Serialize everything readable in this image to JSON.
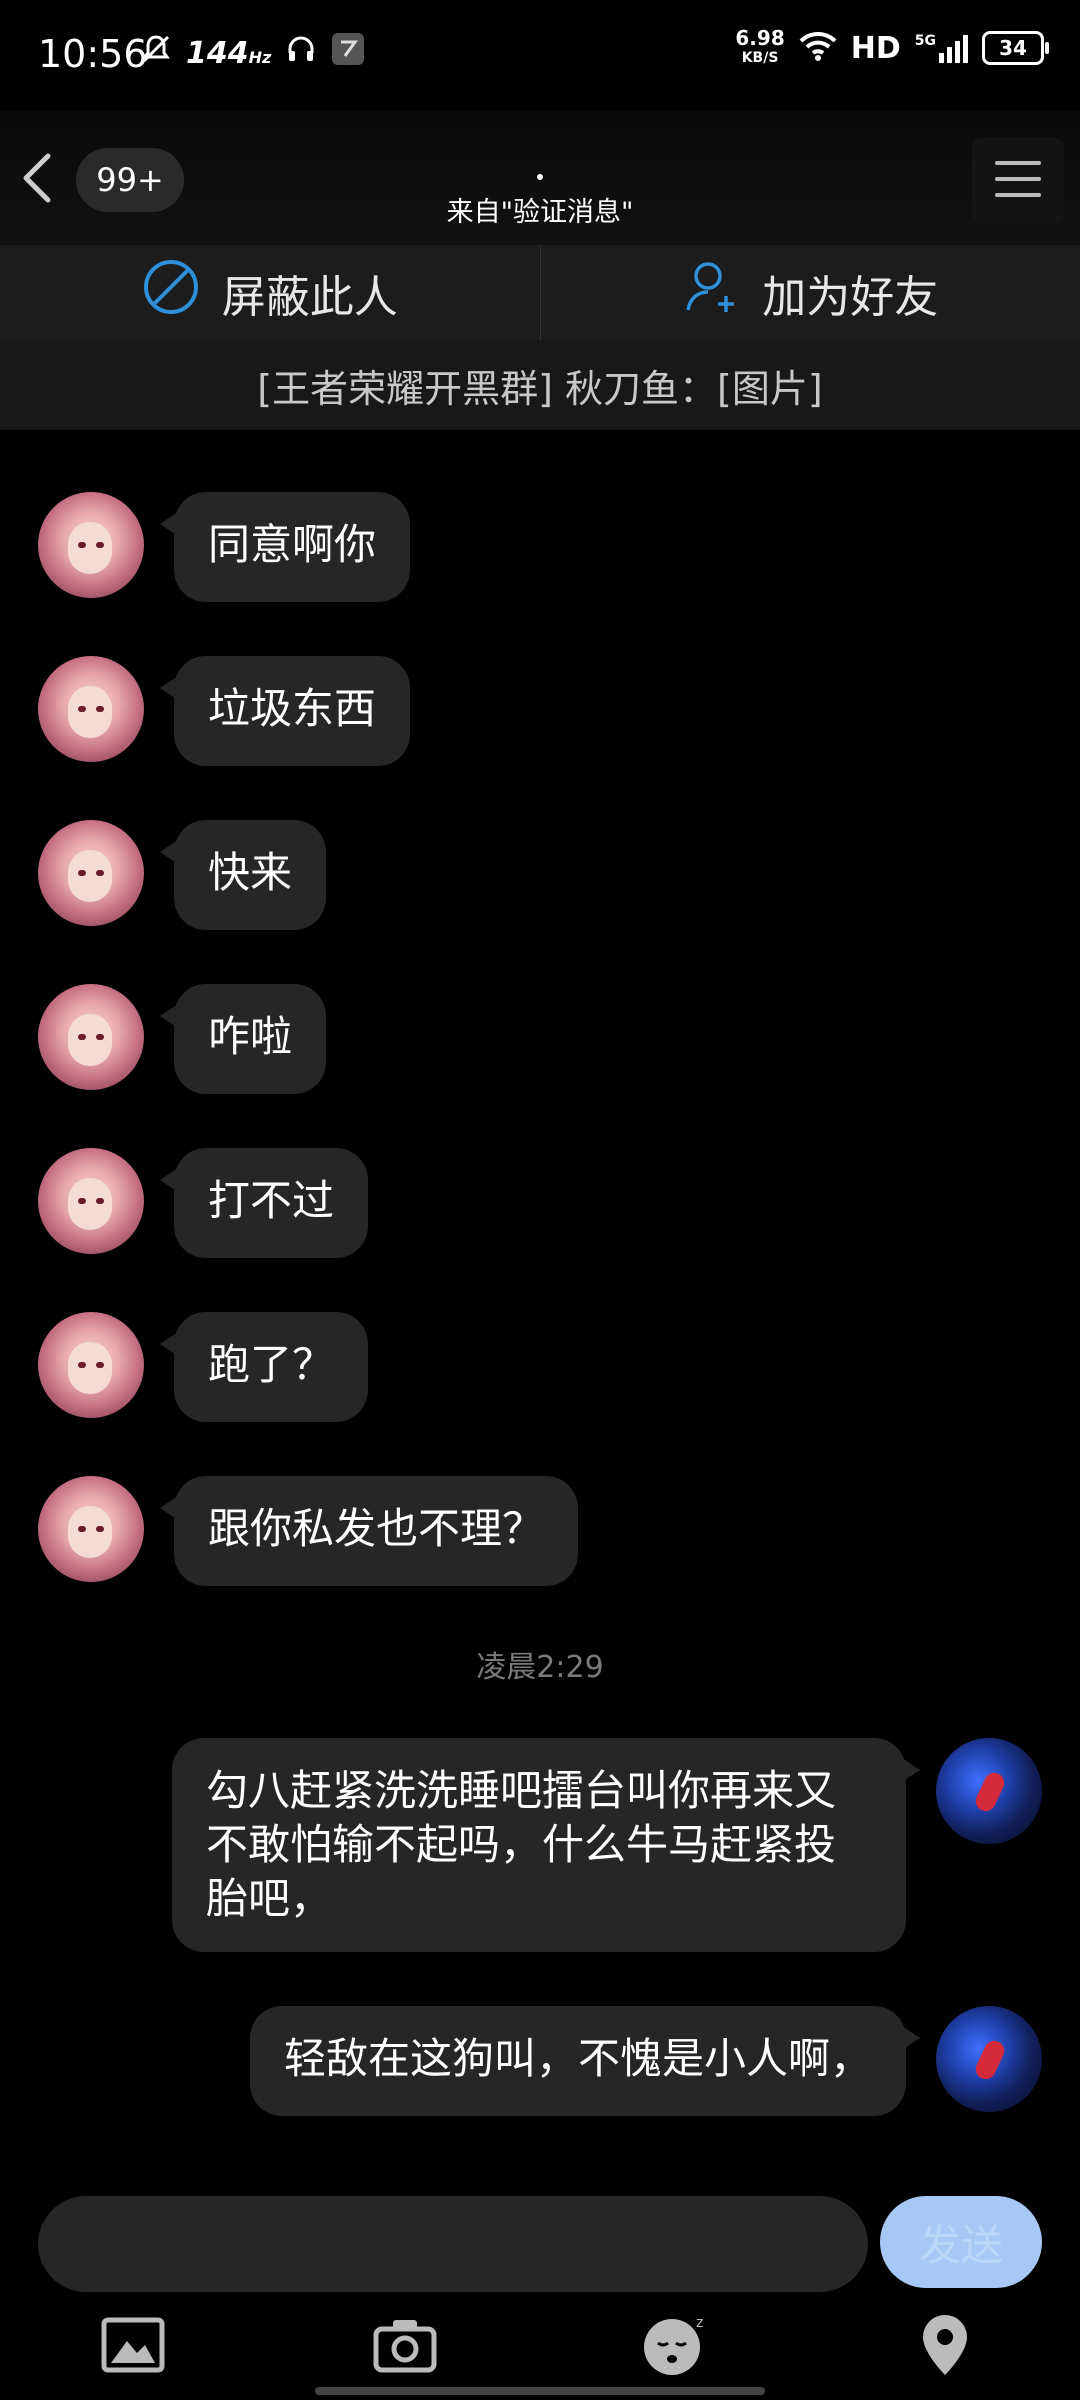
{
  "status_bar": {
    "time": "10:56",
    "refresh_rate": "144",
    "refresh_unit": "Hz",
    "net_speed_value": "6.98",
    "net_speed_unit": "KB/S",
    "hd": "HD",
    "network": "5G",
    "battery": "34"
  },
  "header": {
    "unread_badge": "99+",
    "subtitle": "来自\"验证消息\""
  },
  "action_bar": {
    "block_label": "屏蔽此人",
    "add_friend_label": "加为好友"
  },
  "pinned_message": "[王者荣耀开黑群] 秋刀鱼：[图片]",
  "messages": [
    {
      "side": "left",
      "text": "同意啊你"
    },
    {
      "side": "left",
      "text": "垃圾东西"
    },
    {
      "side": "left",
      "text": "快来"
    },
    {
      "side": "left",
      "text": "咋啦"
    },
    {
      "side": "left",
      "text": "打不过"
    },
    {
      "side": "left",
      "text": "跑了？"
    },
    {
      "side": "left",
      "text": "跟你私发也不理？"
    },
    {
      "side": "right",
      "text": "勾八赶紧洗洗睡吧擂台叫你再来又不敢怕输不起吗，什么牛马赶紧投胎吧，"
    },
    {
      "side": "right",
      "text": "轻敌在这狗叫，不愧是小人啊，"
    }
  ],
  "time_divider": "凌晨2:29",
  "input": {
    "placeholder": "",
    "send_label": "发送"
  },
  "toolbar": {
    "icons": [
      "image-icon",
      "camera-icon",
      "emoji-icon",
      "location-icon"
    ]
  },
  "colors": {
    "background": "#000000",
    "bubble": "#262626",
    "accent_blue": "#2f8fd8",
    "send_button": "#a7c8f5"
  }
}
